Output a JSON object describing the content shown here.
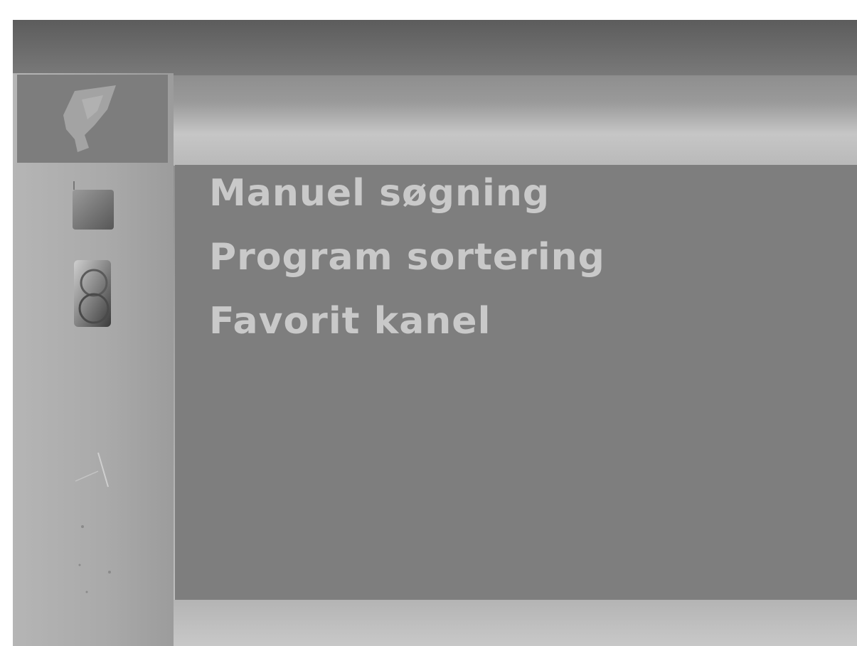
{
  "sidebar": {
    "icons": [
      {
        "name": "satellite-dish-icon",
        "selected": true
      },
      {
        "name": "tv-icon",
        "selected": false
      },
      {
        "name": "clock-icon",
        "selected": false
      }
    ]
  },
  "menu": {
    "items": [
      {
        "label": "Manuel søgning"
      },
      {
        "label": "Program sortering"
      },
      {
        "label": "Favorit kanel"
      }
    ]
  }
}
